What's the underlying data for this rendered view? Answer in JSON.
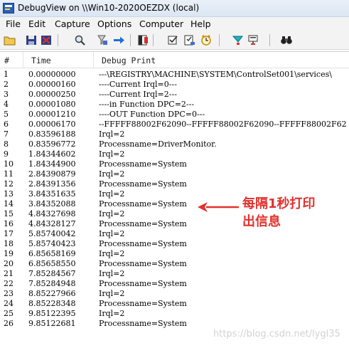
{
  "window": {
    "title": "DebugView on \\\\Win10-2020OEZDX (local)"
  },
  "menu": [
    {
      "label": "File"
    },
    {
      "label": "Edit"
    },
    {
      "label": "Capture"
    },
    {
      "label": "Options"
    },
    {
      "label": "Computer"
    },
    {
      "label": "Help"
    }
  ],
  "toolbar": {
    "buttons": [
      "open-icon",
      "save-icon",
      "clear-display-icon",
      "find-icon",
      "filter-icon",
      "scroll-icon",
      "capture-icon",
      "clock-time-icon",
      "elapsed-time-icon",
      "autoscroll-icon",
      "highlight-icon",
      "history-icon",
      "binoculars-icon"
    ]
  },
  "columns": {
    "num": "#",
    "time": "Time",
    "print": "Debug Print"
  },
  "rows": [
    {
      "num": "1",
      "time": "0.00000000",
      "print": "---\\REGISTRY\\MACHINE\\SYSTEM\\ControlSet001\\services\\"
    },
    {
      "num": "2",
      "time": "0.00000160",
      "print": "----Current Irql=0---"
    },
    {
      "num": "3",
      "time": "0.00000250",
      "print": "----Current Irql=2---"
    },
    {
      "num": "4",
      "time": "0.00001080",
      "print": "----in Function DPC=2---"
    },
    {
      "num": "5",
      "time": "0.00001210",
      "print": "----OUT Function DPC=0---"
    },
    {
      "num": "6",
      "time": "0.00006170",
      "print": "--FFFFF88002F62090--FFFFF88002F62090--FFFFF88002F62"
    },
    {
      "num": "7",
      "time": "0.83596188",
      "print": "Irql=2"
    },
    {
      "num": "8",
      "time": "0.83596772",
      "print": "Processname=DriverMonitor."
    },
    {
      "num": "9",
      "time": "1.84344602",
      "print": "Irql=2"
    },
    {
      "num": "10",
      "time": "1.84344900",
      "print": "Processname=System"
    },
    {
      "num": "11",
      "time": "2.84390879",
      "print": "Irql=2"
    },
    {
      "num": "12",
      "time": "2.84391356",
      "print": "Processname=System"
    },
    {
      "num": "13",
      "time": "3.84351635",
      "print": "Irql=2"
    },
    {
      "num": "14",
      "time": "3.84352088",
      "print": "Processname=System"
    },
    {
      "num": "15",
      "time": "4.84327698",
      "print": "Irql=2"
    },
    {
      "num": "16",
      "time": "4.84328127",
      "print": "Processname=System"
    },
    {
      "num": "17",
      "time": "5.85740042",
      "print": "Irql=2"
    },
    {
      "num": "18",
      "time": "5.85740423",
      "print": "Processname=System"
    },
    {
      "num": "19",
      "time": "6.85658169",
      "print": "Irql=2"
    },
    {
      "num": "20",
      "time": "6.85658550",
      "print": "Processname=System"
    },
    {
      "num": "21",
      "time": "7.85284567",
      "print": "Irql=2"
    },
    {
      "num": "22",
      "time": "7.85284948",
      "print": "Processname=System"
    },
    {
      "num": "23",
      "time": "8.85227966",
      "print": "Irql=2"
    },
    {
      "num": "24",
      "time": "8.85228348",
      "print": "Processname=System"
    },
    {
      "num": "25",
      "time": "9.85122395",
      "print": "Irql=2"
    },
    {
      "num": "26",
      "time": "9.85122681",
      "print": "Processname=System"
    }
  ],
  "annotation": {
    "line1": "每隔1秒打印",
    "line2": "出信息",
    "color": "#e0322e"
  },
  "watermark": "https://blog.csdn.net/lygl35"
}
